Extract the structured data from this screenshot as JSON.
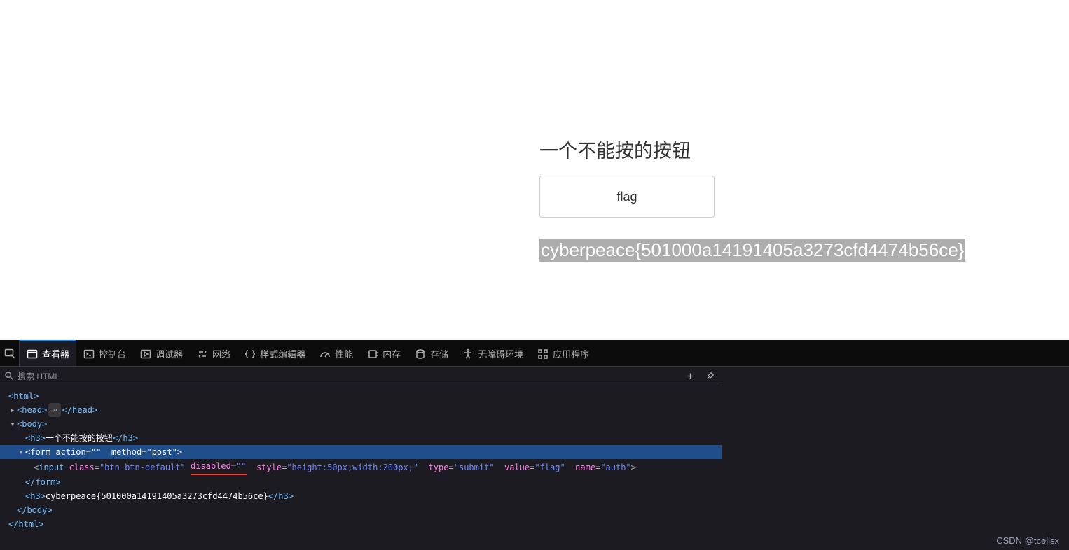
{
  "page": {
    "title": "一个不能按的按钮",
    "button_value": "flag",
    "result": "cyberpeace{501000a14191405a3273cfd4474b56ce}"
  },
  "devtools": {
    "tabs": {
      "inspector": "查看器",
      "console": "控制台",
      "debugger": "调试器",
      "network": "网络",
      "style": "样式编辑器",
      "performance": "性能",
      "memory": "内存",
      "storage": "存储",
      "accessibility": "无障碍环境",
      "application": "应用程序"
    },
    "search_placeholder": "搜索 HTML",
    "dom": {
      "html_open": "<html>",
      "head_open": "<head>",
      "head_close": "</head>",
      "body_open": "<body>",
      "h3_button_open": "<h3>",
      "h3_button_text": "一个不能按的按钮",
      "h3_close": "</h3>",
      "form_tag": "form",
      "form_action_attr": "action",
      "form_action_val": "\"\"",
      "form_method_attr": "method",
      "form_method_val": "\"post\"",
      "input_tag": "input",
      "input_class_attr": "class",
      "input_class_val": "\"btn btn-default\"",
      "input_disabled_attr": "disabled",
      "input_disabled_val": "\"\"",
      "input_style_attr": "style",
      "input_style_val": "\"height:50px;width:200px;\"",
      "input_type_attr": "type",
      "input_type_val": "\"submit\"",
      "input_value_attr": "value",
      "input_value_val": "\"flag\"",
      "input_name_attr": "name",
      "input_name_val": "\"auth\"",
      "form_close": "</form>",
      "h3_open": "<h3>",
      "h3_flag_text": "cyberpeace{501000a14191405a3273cfd4474b56ce}",
      "body_close": "</body>",
      "html_close": "</html>"
    }
  },
  "watermark": "CSDN @tcellsx"
}
